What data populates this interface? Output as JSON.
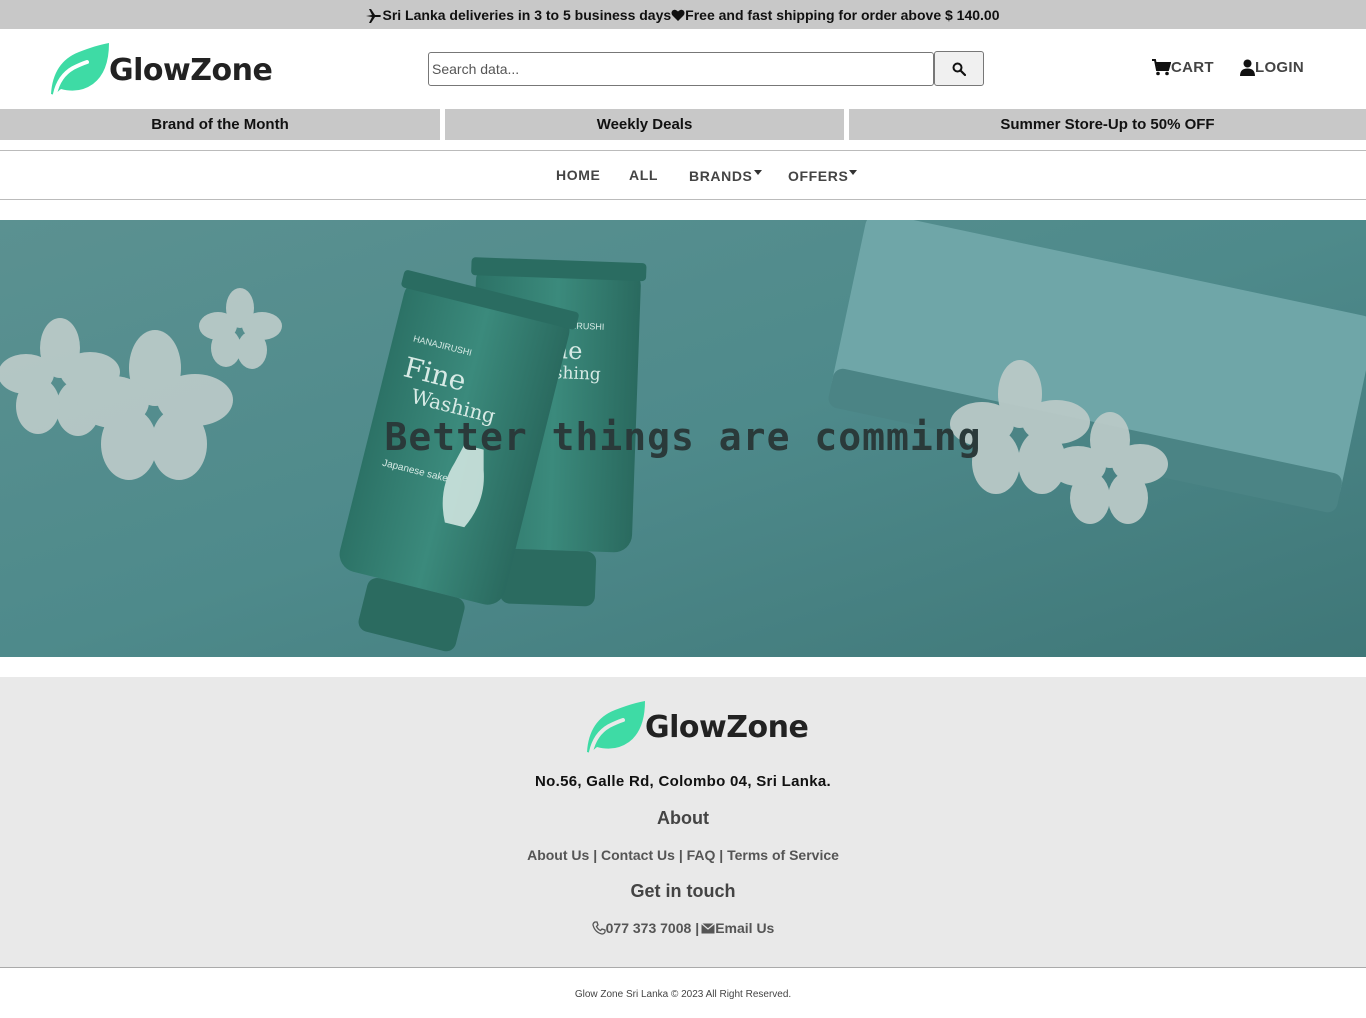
{
  "announcement": {
    "delivery_text": "Sri Lanka deliveries in 3 to 5 business days",
    "shipping_text": "Free and fast shipping for order above $ 140.00",
    "icons": [
      "airplane-icon",
      "heart-icon"
    ]
  },
  "header": {
    "logo_text": "GlowZone",
    "search_placeholder": "Search data...",
    "cart_label": "CART",
    "login_label": "LOGIN",
    "brand_color": "#3edba5"
  },
  "promo_bar": {
    "items": [
      {
        "label": "Brand of the Month"
      },
      {
        "label": "Weekly Deals"
      },
      {
        "label": "Summer Store-Up to 50% OFF"
      }
    ]
  },
  "main_nav": {
    "items": [
      {
        "label": "HOME",
        "has_dropdown": false
      },
      {
        "label": "ALL",
        "has_dropdown": false
      },
      {
        "label": "BRANDS",
        "has_dropdown": true
      },
      {
        "label": "OFFERS",
        "has_dropdown": true
      }
    ]
  },
  "hero": {
    "title": "Better things are comming",
    "tube_brand": "HANAJIRUSHI",
    "tube_product": "Fine Washing",
    "tube_product_line1": "Fine",
    "tube_product_line2": "Washing",
    "tube_subtitle": "Japanese sake"
  },
  "footer": {
    "logo_text": "GlowZone",
    "address": "No.56, Galle Rd, Colombo 04, Sri Lanka.",
    "about_heading": "About",
    "links": {
      "about": "About Us",
      "contact": "Contact Us",
      "faq": "FAQ",
      "terms": "Terms of Service",
      "separator": "|"
    },
    "contact_heading": "Get in touch",
    "phone": "077 373 7008",
    "email_label": "Email Us",
    "contact_separator": "|"
  },
  "copyright": "Glow Zone Sri Lanka © 2023 All Right Reserved."
}
